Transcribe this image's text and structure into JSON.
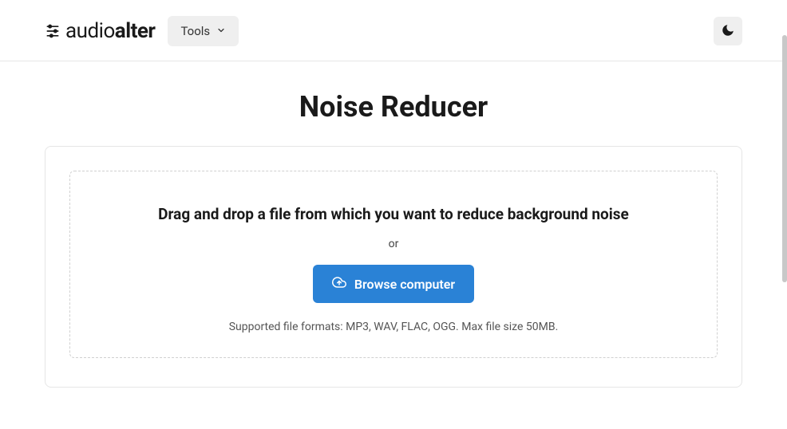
{
  "brand": {
    "name_part1": "audio",
    "name_part2": "alter"
  },
  "nav": {
    "tools_label": "Tools"
  },
  "page": {
    "title": "Noise Reducer"
  },
  "dropzone": {
    "heading": "Drag and drop a file from which you want to reduce background noise",
    "or_label": "or",
    "browse_label": "Browse computer",
    "supported_text": "Supported file formats: MP3, WAV, FLAC, OGG. Max file size 50MB."
  }
}
